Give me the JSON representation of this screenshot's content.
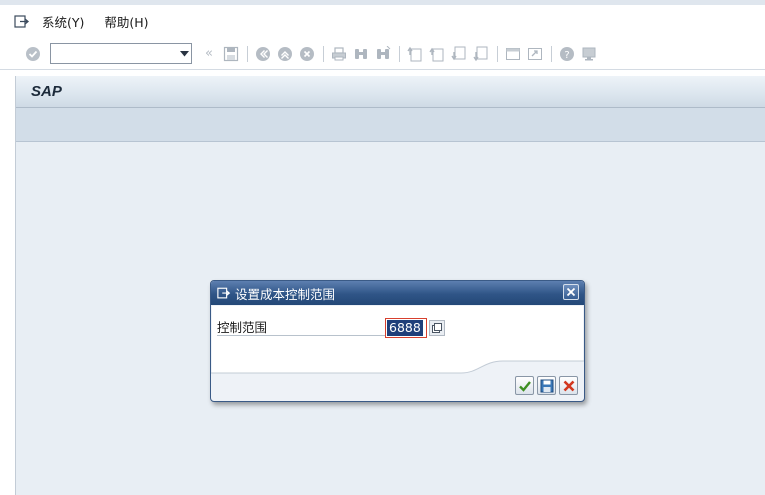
{
  "menubar": {
    "items": [
      {
        "label": "系统(Y)"
      },
      {
        "label": "帮助(H)"
      }
    ]
  },
  "toolbar": {
    "command_field": {
      "value": "",
      "placeholder": ""
    }
  },
  "screen": {
    "title": "SAP"
  },
  "dialog": {
    "title": "设置成本控制范围",
    "field": {
      "label": "控制范围",
      "value": "6888"
    }
  },
  "colors": {
    "accent": "#244877",
    "workarea": "#e8eef4",
    "selection": "#1f3f7a",
    "required_border": "#d7402e"
  }
}
